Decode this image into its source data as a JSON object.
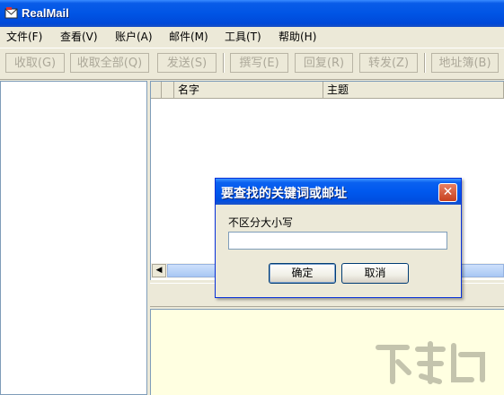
{
  "window": {
    "title": "RealMail"
  },
  "menu": [
    "文件(F)",
    "查看(V)",
    "账户(A)",
    "邮件(M)",
    "工具(T)",
    "帮助(H)"
  ],
  "toolbar": [
    "收取(G)",
    "收取全部(Q)",
    "发送(S)",
    "撰写(E)",
    "回复(R)",
    "转发(Z)",
    "地址簿(B)"
  ],
  "list": {
    "columns": [
      "名字",
      "主题"
    ]
  },
  "dialog": {
    "title": "要查找的关键词或邮址",
    "label": "不区分大小写",
    "input_value": "",
    "ok_label": "确定",
    "cancel_label": "取消"
  },
  "colors": {
    "title_blue": "#0055e5",
    "preview_bg": "#ffffe1",
    "close_red": "#c7411e"
  }
}
